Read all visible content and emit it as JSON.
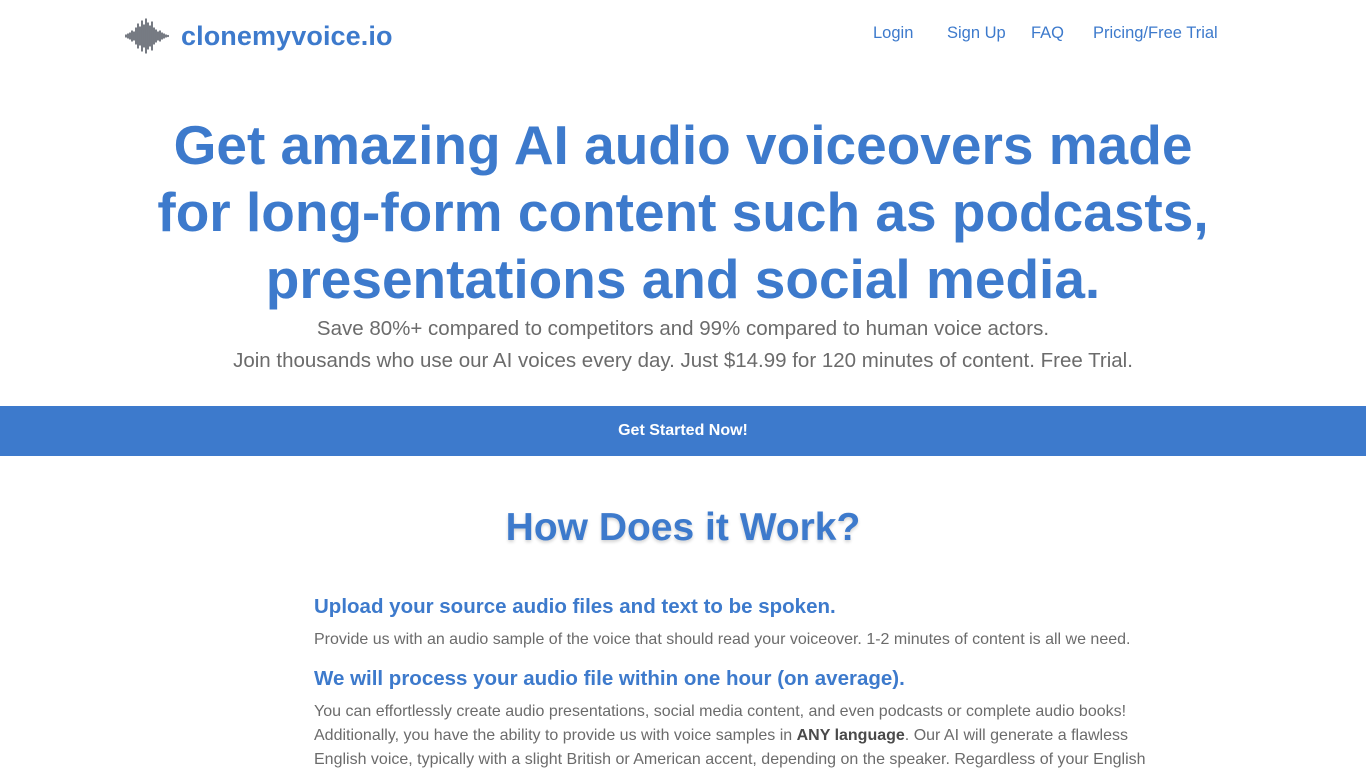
{
  "brand": {
    "name": "clonemyvoice.io",
    "logo_icon": "waveform-icon"
  },
  "nav": {
    "links": [
      {
        "label": "Login"
      },
      {
        "label": "Sign Up"
      },
      {
        "label": "FAQ"
      },
      {
        "label": "Pricing/Free Trial"
      }
    ]
  },
  "hero": {
    "title_lines": [
      "Get amazing AI audio voiceovers made",
      "for long-form content such as podcasts,",
      "presentations and social media."
    ],
    "subtitle_lines": [
      "Save 80%+ compared to competitors and 99% compared to human voice actors.",
      "Join thousands who use our AI voices every day. Just $14.99 for 120 minutes of content. Free Trial."
    ]
  },
  "cta": {
    "label": "Get Started Now!"
  },
  "how": {
    "title": "How Does it Work?",
    "steps": [
      {
        "heading": "Upload your source audio files and text to be spoken.",
        "text": "Provide us with an audio sample of the voice that should read your voiceover. 1-2 minutes of content is all we need."
      },
      {
        "heading": "We will process your audio file within one hour (on average).",
        "line1": "You can effortlessly create audio presentations, social media content, and even podcasts or complete audio books!",
        "line2_before": "Additionally, you have the ability to provide us with voice samples in ",
        "line2_bold": "ANY language",
        "line2_after": ". Our AI will generate a flawless",
        "line3": "English voice, typically with a slight British or American accent, depending on the speaker. Regardless of your English"
      }
    ]
  },
  "colors": {
    "accent": "#3d7acc",
    "text": "#6b6b6b",
    "background": "#ffffff",
    "cta_text": "#ffffff"
  }
}
